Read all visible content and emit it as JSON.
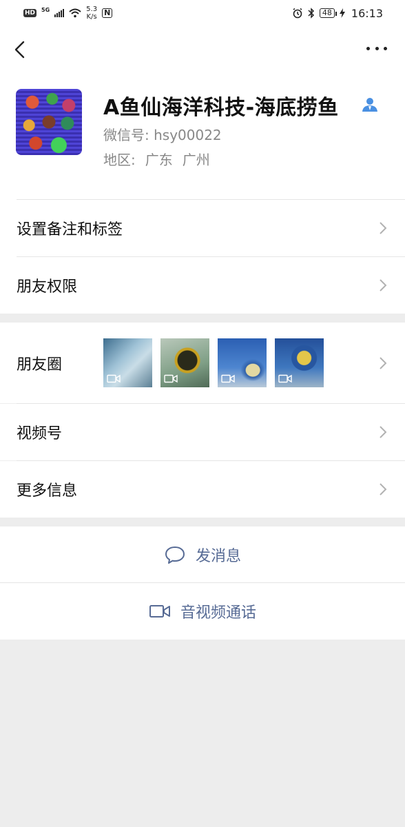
{
  "status_bar": {
    "hd": "HD",
    "network": "5G",
    "speed_value": "5.3",
    "speed_unit": "K/s",
    "nfc": "N",
    "battery": "48",
    "time": "16:13"
  },
  "profile": {
    "name": "A鱼仙海洋科技-海底捞鱼",
    "wechat_id": "微信号: hsy00022",
    "region_label": "地区:",
    "region_province": "广东",
    "region_city": "广州"
  },
  "settings": {
    "remark_tags": "设置备注和标签",
    "friend_permissions": "朋友权限"
  },
  "moments": {
    "label": "朋友圈",
    "thumbnails": [
      "video",
      "video",
      "video",
      "video"
    ]
  },
  "channels": {
    "label": "视频号"
  },
  "more_info": {
    "label": "更多信息"
  },
  "actions": {
    "send_message": "发消息",
    "av_call": "音视频通话"
  },
  "colors": {
    "link_blue": "#576b95",
    "background": "#ededed",
    "verified_icon": "#4a90e2"
  }
}
